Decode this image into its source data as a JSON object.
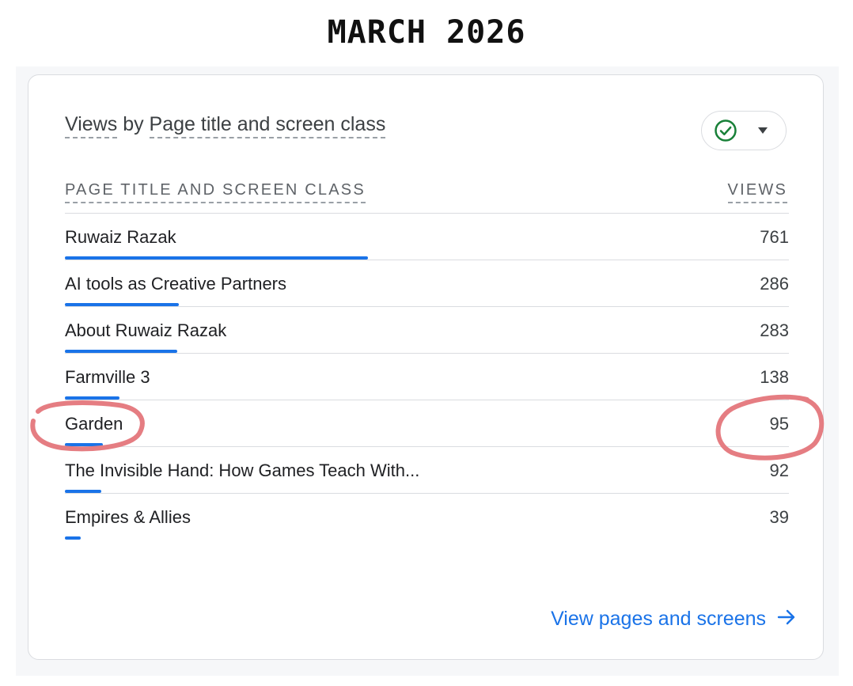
{
  "heading": "MARCH 2026",
  "card": {
    "title_prefix": "Views",
    "title_middle": " by ",
    "title_suffix": "Page title and screen class",
    "status_icon": "check-circle-icon",
    "dropdown_icon": "caret-down-icon"
  },
  "table": {
    "col_dimension": "PAGE TITLE AND SCREEN CLASS",
    "col_metric": "VIEWS",
    "rows": [
      {
        "label": "Ruwaiz Razak",
        "value": "761",
        "bar_fraction": 1.0
      },
      {
        "label": "AI tools as Creative Partners",
        "value": "286",
        "bar_fraction": 0.376
      },
      {
        "label": "About Ruwaiz Razak",
        "value": "283",
        "bar_fraction": 0.372
      },
      {
        "label": "Farmville 3",
        "value": "138",
        "bar_fraction": 0.181
      },
      {
        "label": "Garden",
        "value": "95",
        "bar_fraction": 0.125
      },
      {
        "label": "The Invisible Hand: How Games Teach With...",
        "value": "92",
        "bar_fraction": 0.121
      },
      {
        "label": "Empires & Allies",
        "value": "39",
        "bar_fraction": 0.051
      }
    ]
  },
  "footer": {
    "link_label": "View pages and screens",
    "link_icon": "arrow-right-icon"
  },
  "colors": {
    "accent": "#1a73e8",
    "success": "#188038",
    "highlight": "#e57d82"
  }
}
